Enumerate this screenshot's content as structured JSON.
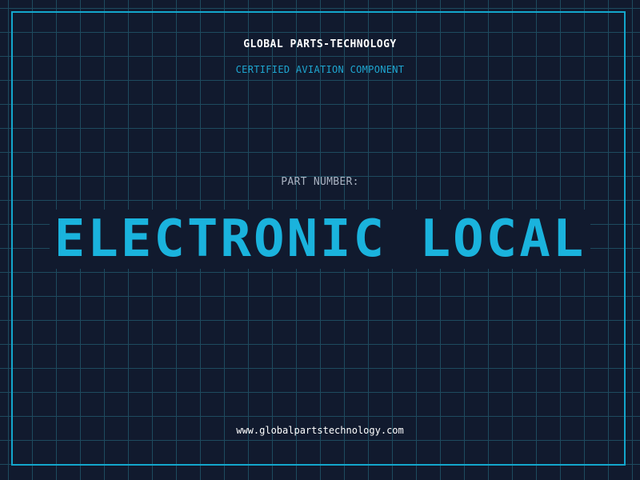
{
  "brand": {
    "name": "GLOBAL PARTS-TECHNOLOGY",
    "tagline": "CERTIFIED AVIATION COMPONENT"
  },
  "part": {
    "label": "PART NUMBER:",
    "value": "ELECTRONIC LOCAL"
  },
  "footer": {
    "website": "www.globalpartstechnology.com"
  },
  "colors": {
    "background": "#111a2e",
    "grid": "#1e4a5e",
    "accent": "#13a6cc",
    "part_value": "#1ab3dd",
    "label": "#aab3c2",
    "text": "#ffffff"
  }
}
